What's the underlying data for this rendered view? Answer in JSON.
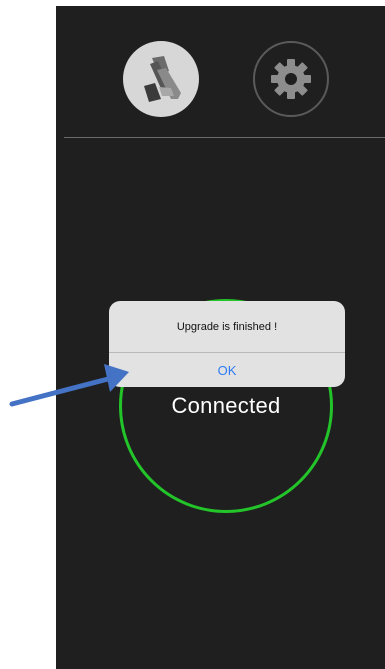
{
  "toolbar": {
    "items": [
      {
        "name": "card-reader-icon",
        "state": "active"
      },
      {
        "name": "gear-icon",
        "state": "inactive"
      }
    ]
  },
  "status": {
    "label": "Connected",
    "ring_color": "#23c42a"
  },
  "alert": {
    "message": "Upgrade is finished !",
    "ok_label": "OK",
    "button_color": "#2f7cf6"
  },
  "annotation": {
    "arrow_color": "#4472c4"
  }
}
